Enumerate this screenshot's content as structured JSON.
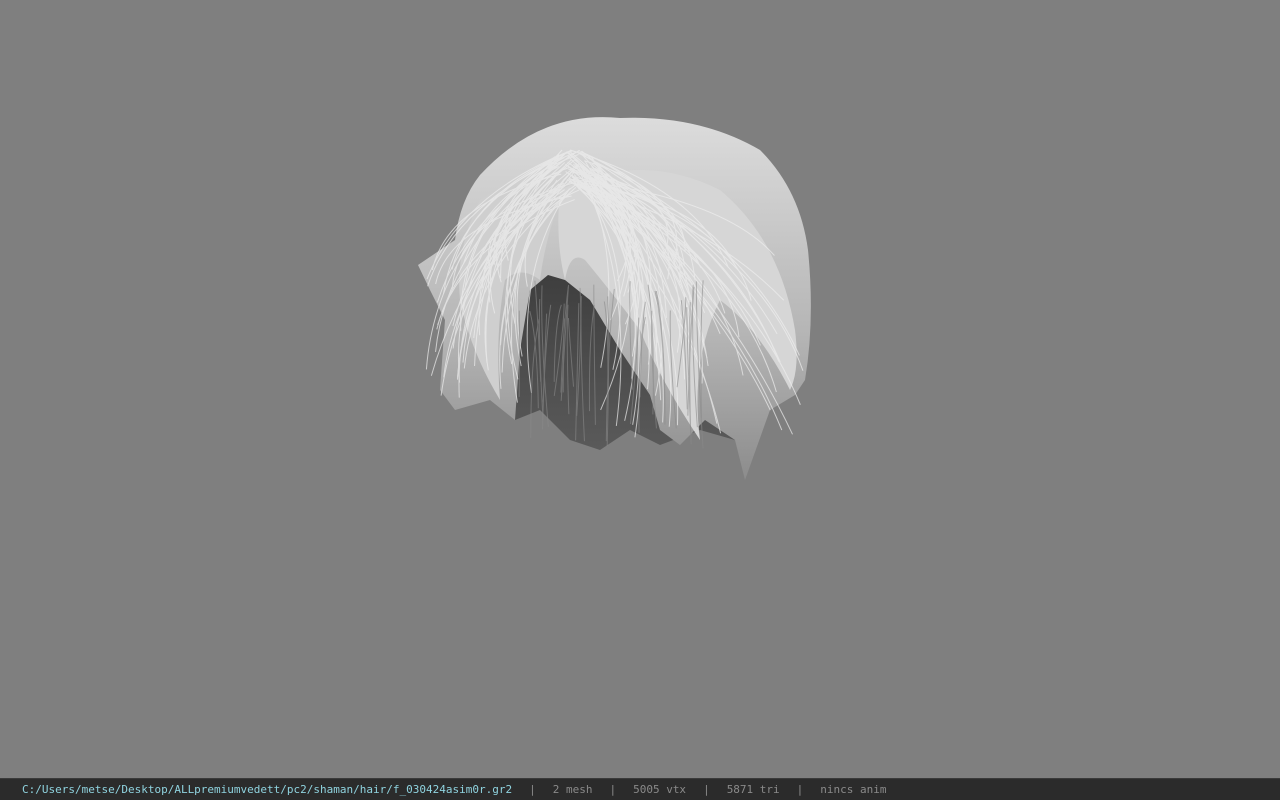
{
  "viewport": {
    "background_color": "#7f7f7f",
    "model": {
      "icon": "hair-mesh-model",
      "color": "#c8c8c8",
      "shadow_color": "#4a4a4a"
    }
  },
  "statusbar": {
    "file_path": "C:/Users/metse/Desktop/ALLpremiumvedett/pc2/shaman/hair/f_030424asim0r.gr2",
    "separator": "|",
    "mesh": "2 mesh",
    "vtx": "5005 vtx",
    "tri": "5871 tri",
    "anim": "nincs anim",
    "path_color": "#8fd3df",
    "text_color": "#8a8a8a"
  }
}
